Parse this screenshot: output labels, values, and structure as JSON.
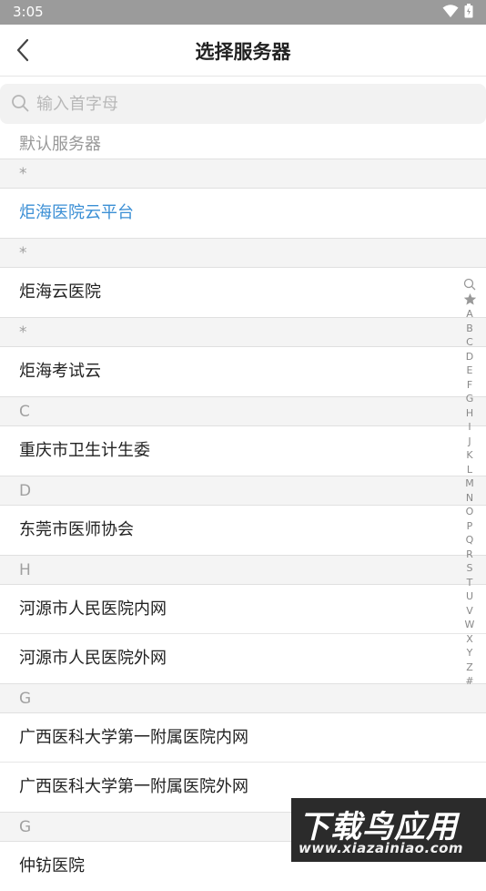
{
  "status_bar": {
    "time": "3:05"
  },
  "header": {
    "title": "选择服务器"
  },
  "search": {
    "placeholder": "输入首字母",
    "value": ""
  },
  "default_label": "默认服务器",
  "sections": [
    {
      "header": "*",
      "items": [
        "炬海医院云平台"
      ]
    },
    {
      "header": "*",
      "items": [
        "炬海云医院"
      ]
    },
    {
      "header": "*",
      "items": [
        "炬海考试云"
      ]
    },
    {
      "header": "C",
      "items": [
        "重庆市卫生计生委"
      ]
    },
    {
      "header": "D",
      "items": [
        "东莞市医师协会"
      ]
    },
    {
      "header": "H",
      "items": [
        "河源市人民医院内网",
        "河源市人民医院外网"
      ]
    },
    {
      "header": "G",
      "items": [
        "广西医科大学第一附属医院内网",
        "广西医科大学第一附属医院外网"
      ]
    },
    {
      "header": "G",
      "items": [
        "仲钫医院"
      ]
    }
  ],
  "selected_item": "炬海医院云平台",
  "index_letters": [
    "A",
    "B",
    "C",
    "D",
    "E",
    "F",
    "G",
    "H",
    "I",
    "J",
    "K",
    "L",
    "M",
    "N",
    "O",
    "P",
    "Q",
    "R",
    "S",
    "T",
    "U",
    "V",
    "W",
    "X",
    "Y",
    "Z",
    "#"
  ],
  "watermark": {
    "title": "下载鸟应用",
    "url": "www.xiazainiao.com"
  },
  "colors": {
    "accent": "#3b8fd5",
    "status_bar": "#9b9b9b",
    "section_bg": "#f4f4f4"
  }
}
